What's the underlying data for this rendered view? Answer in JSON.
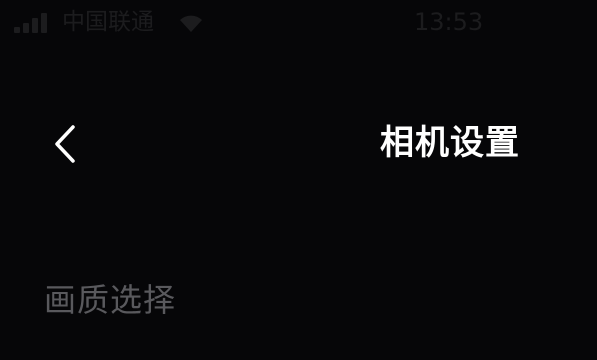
{
  "status_bar": {
    "carrier": "中国联通",
    "time": "13:53",
    "signal_bars": 4,
    "icons": [
      "signal-icon",
      "wifi-icon"
    ]
  },
  "nav": {
    "back_icon": "chevron-left-icon",
    "title": "相机设置"
  },
  "section": {
    "label": "画质选择"
  },
  "colors": {
    "background": "#060608",
    "title_text": "#ffffff",
    "section_text": "#59595d",
    "status_text": "#1c1c1e"
  }
}
